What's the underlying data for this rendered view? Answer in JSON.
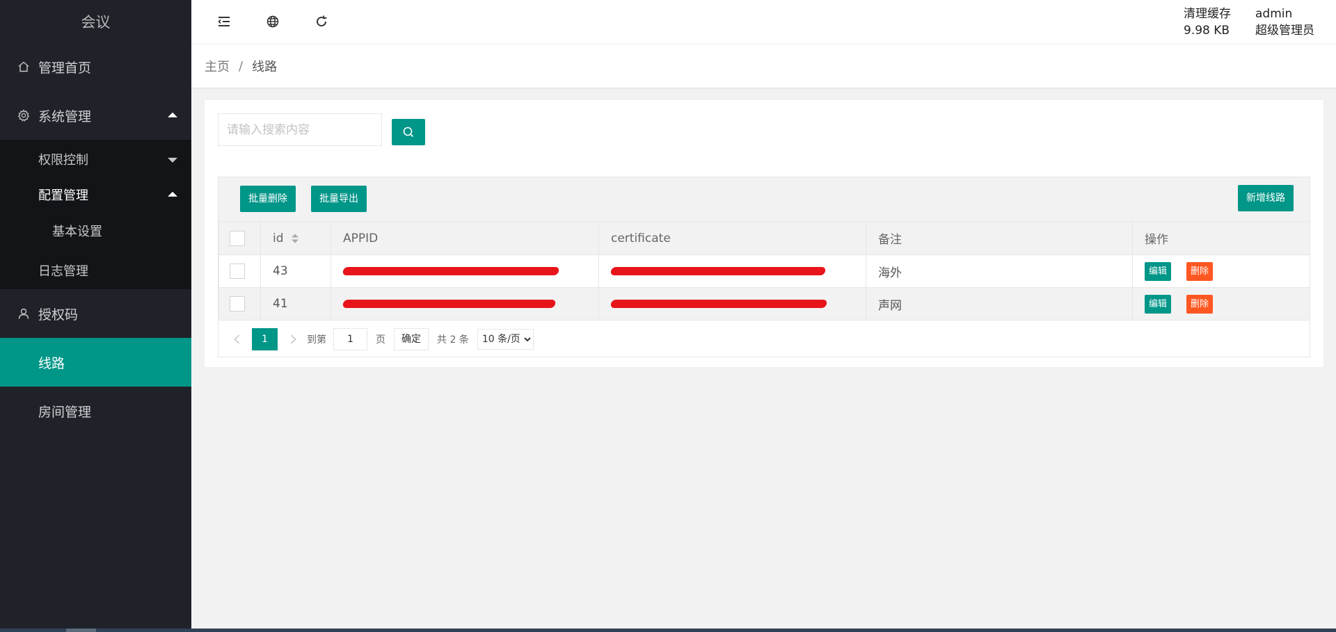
{
  "sidebar": {
    "logo": "会议",
    "items": [
      {
        "label": "管理首页",
        "icon": "home-icon"
      },
      {
        "label": "系统管理",
        "icon": "gear-icon"
      },
      {
        "label": "授权码",
        "icon": "user-icon"
      },
      {
        "label": "线路",
        "icon": "none"
      },
      {
        "label": "房间管理",
        "icon": "none"
      }
    ],
    "sub_items": [
      {
        "label": "权限控制"
      },
      {
        "label": "配置管理"
      }
    ],
    "subsub_items": [
      {
        "label": "基本设置"
      }
    ],
    "log_label": "日志管理",
    "active_color": "#009688",
    "bg_color": "#20222a"
  },
  "header": {
    "icons": [
      "menu-collapse-icon",
      "globe-icon",
      "refresh-icon"
    ],
    "cache_label": "清理缓存",
    "cache_size": "9.98 KB",
    "user_name": "admin",
    "user_role": "超级管理员"
  },
  "breadcrumb": {
    "home": "主页",
    "separator": "/",
    "current": "线路"
  },
  "search": {
    "placeholder": "请输入搜索内容"
  },
  "toolbar": {
    "batch_delete": "批量删除",
    "batch_export": "批量导出",
    "add_route": "新增线路"
  },
  "table": {
    "columns": [
      "id",
      "APPID",
      "certificate",
      "备注",
      "操作"
    ],
    "rows": [
      {
        "id": "43",
        "appid": "",
        "certificate": "",
        "remark": "海外"
      },
      {
        "id": "41",
        "appid": "",
        "certificate": "",
        "remark": "声网"
      }
    ],
    "edit_label": "编辑",
    "delete_label": "删除"
  },
  "pager": {
    "current_page": "1",
    "goto_label": "到第",
    "goto_value": "1",
    "page_label": "页",
    "confirm_label": "确定",
    "total_label": "共 2 条",
    "page_size": "10 条/页"
  }
}
